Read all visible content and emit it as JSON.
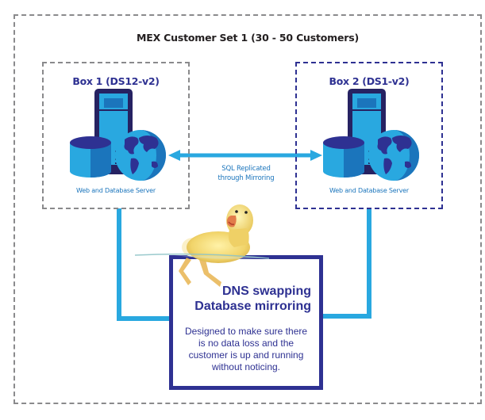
{
  "diagram": {
    "title": "MEX Customer Set 1 (30 - 50 Customers)",
    "boxes": [
      {
        "title": "Box 1 (DS12-v2)",
        "caption": "Web and Database Server",
        "icon": "server-database-globe-icon",
        "border_color": "#8a8a8c"
      },
      {
        "title": "Box 2 (DS1-v2)",
        "caption": "Web and Database Server",
        "icon": "server-database-globe-icon",
        "border_color": "#2e3192"
      }
    ],
    "replication": {
      "line1": "SQL Replicated",
      "line2": "through Mirroring",
      "arrow": "double-headed-arrow"
    },
    "failover": {
      "heading_line1": "DNS swapping",
      "heading_line2": "Database mirroring",
      "description": "Designed to make sure there is no data loss and the customer is up and running without noticing.",
      "image": "swimming-duckling"
    },
    "colors": {
      "navy": "#2e3192",
      "connector_blue": "#29a8e0",
      "caption_blue": "#1b75bc",
      "outer_border": "#8a8a8c",
      "title_text": "#231f20"
    }
  }
}
